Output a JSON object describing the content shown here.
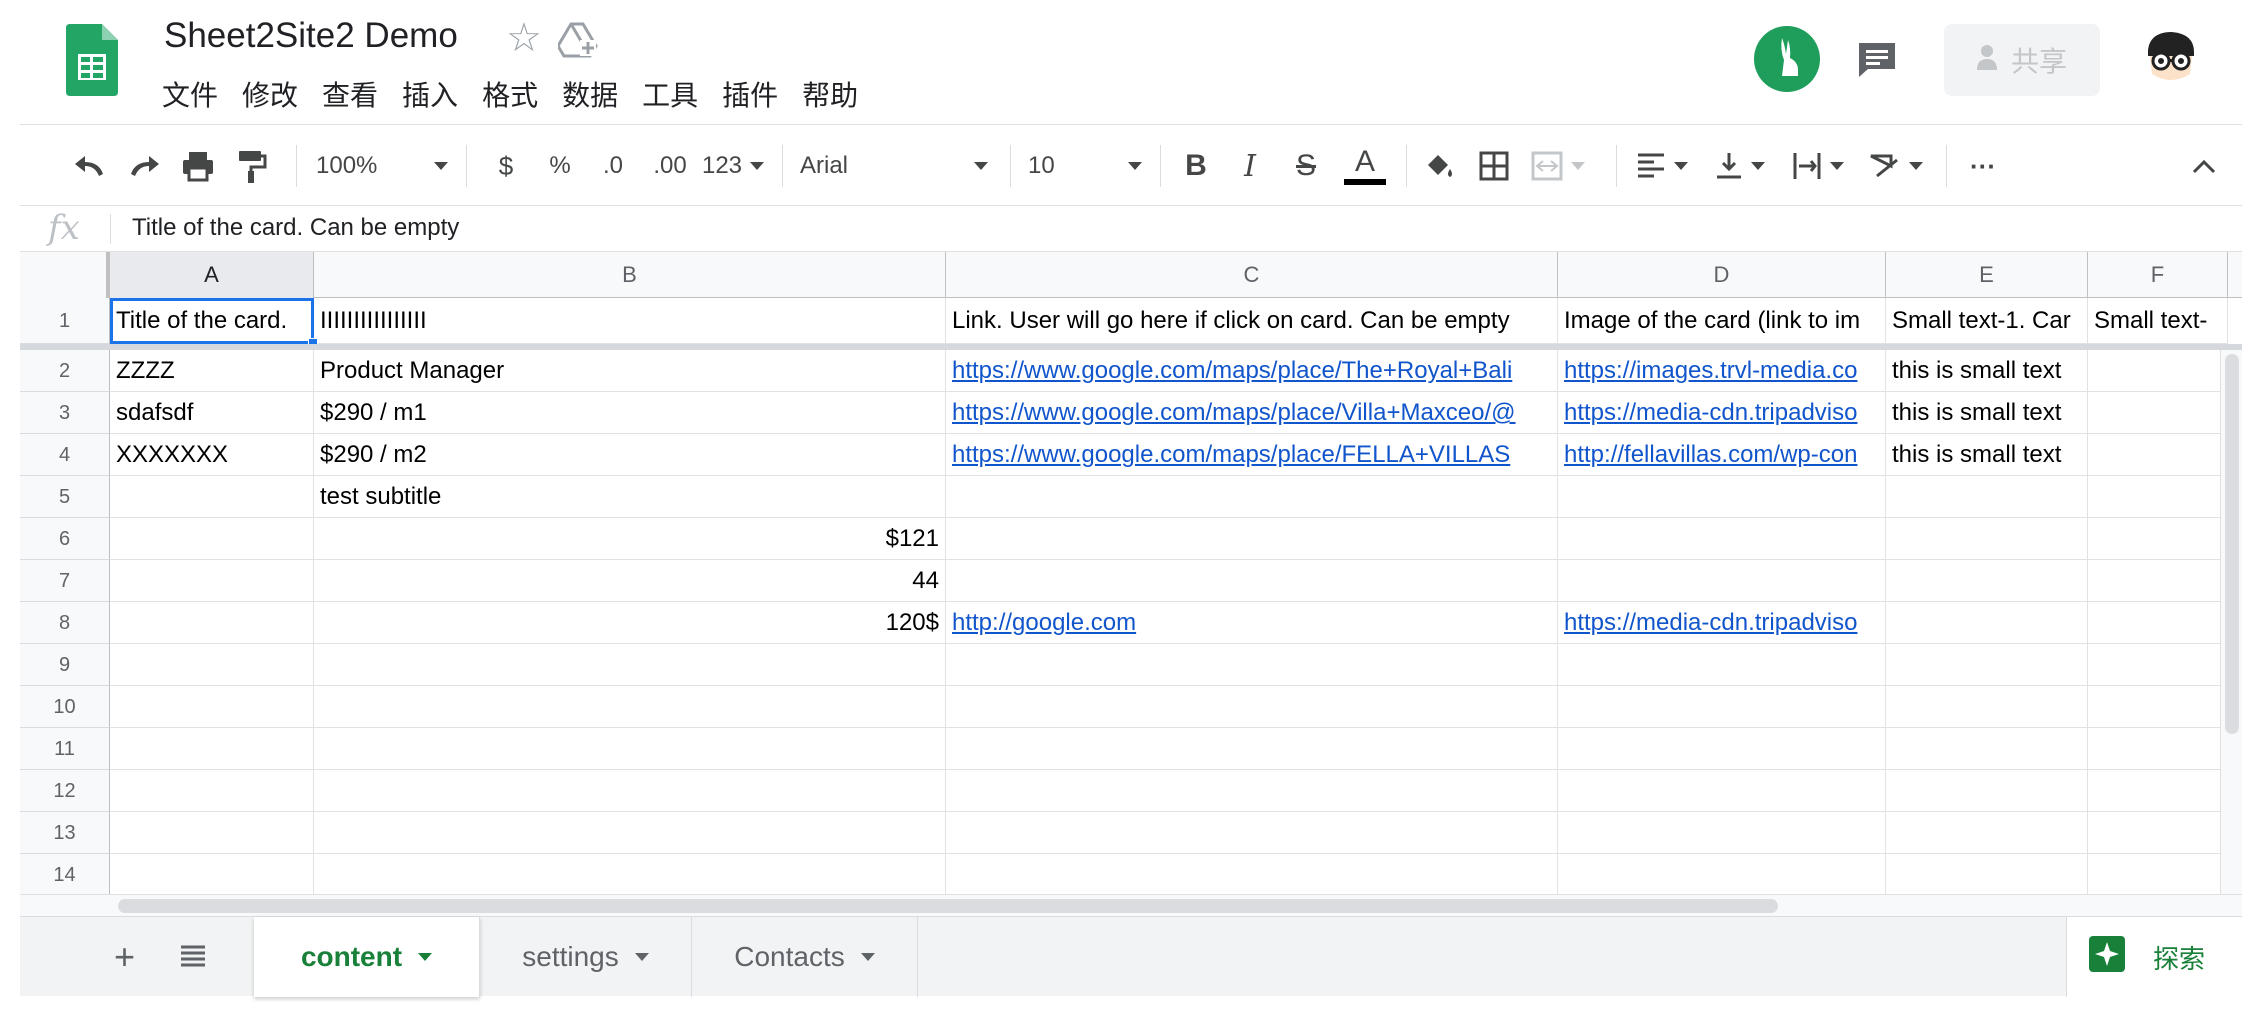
{
  "doc": {
    "title": "Sheet2Site2 Demo"
  },
  "menu": [
    "文件",
    "修改",
    "查看",
    "插入",
    "格式",
    "数据",
    "工具",
    "插件",
    "帮助"
  ],
  "share": {
    "label": "共享"
  },
  "toolbar": {
    "zoom": "100%",
    "currency": "$",
    "percent": "%",
    "dec_decrease": ".0",
    "dec_increase": ".00",
    "format_more": "123",
    "font": "Arial",
    "font_size": "10",
    "bold": "B",
    "italic": "I",
    "strike": "S",
    "text_color": "A",
    "more": "···"
  },
  "formula_bar": {
    "fx": "fx",
    "value": "Title of the card. Can be empty"
  },
  "columns": [
    "A",
    "B",
    "C",
    "D",
    "E",
    "F"
  ],
  "rows": [
    {
      "num": "1",
      "cells": [
        "Title of the card.",
        "IIIIIIIIIIIIIIII",
        "Link. User will go here if click on card. Can be empty",
        "Image of the card (link to im",
        "Small text-1. Car",
        "Small text-"
      ]
    },
    {
      "num": "2",
      "cells": [
        "ZZZZ",
        "Product Manager",
        "https://www.google.com/maps/place/The+Royal+Bali",
        "https://images.trvl-media.co",
        "this is small text",
        ""
      ]
    },
    {
      "num": "3",
      "cells": [
        "sdafsdf",
        "$290 / m1",
        "https://www.google.com/maps/place/Villa+Maxceo/@",
        "https://media-cdn.tripadviso",
        "this is small text",
        ""
      ]
    },
    {
      "num": "4",
      "cells": [
        "XXXXXXX",
        "$290 / m2",
        "https://www.google.com/maps/place/FELLA+VILLAS",
        "http://fellavillas.com/wp-con",
        "this is small text",
        ""
      ]
    },
    {
      "num": "5",
      "cells": [
        "",
        "test subtitle",
        "",
        "",
        "",
        ""
      ]
    },
    {
      "num": "6",
      "cells": [
        "",
        "$121",
        "",
        "",
        "",
        ""
      ]
    },
    {
      "num": "7",
      "cells": [
        "",
        "44",
        "",
        "",
        "",
        ""
      ]
    },
    {
      "num": "8",
      "cells": [
        "",
        "120$",
        "http://google.com",
        "https://media-cdn.tripadviso",
        "",
        ""
      ]
    },
    {
      "num": "9",
      "cells": [
        "",
        "",
        "",
        "",
        "",
        ""
      ]
    },
    {
      "num": "10",
      "cells": [
        "",
        "",
        "",
        "",
        "",
        ""
      ]
    },
    {
      "num": "11",
      "cells": [
        "",
        "",
        "",
        "",
        "",
        ""
      ]
    },
    {
      "num": "12",
      "cells": [
        "",
        "",
        "",
        "",
        "",
        ""
      ]
    },
    {
      "num": "13",
      "cells": [
        "",
        "",
        "",
        "",
        "",
        ""
      ]
    },
    {
      "num": "14",
      "cells": [
        "",
        "",
        "",
        "",
        "",
        ""
      ]
    }
  ],
  "sheet_tabs": [
    {
      "label": "content",
      "active": true
    },
    {
      "label": "settings",
      "active": false
    },
    {
      "label": "Contacts",
      "active": false
    }
  ],
  "explore": {
    "label": "探索"
  },
  "colors": {
    "accent_green": "#188038",
    "link": "#1155cc",
    "selection": "#1a73e8"
  }
}
